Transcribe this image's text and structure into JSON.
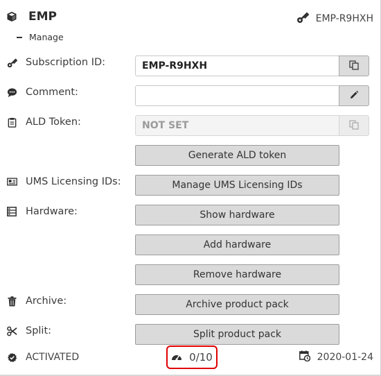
{
  "header": {
    "title": "EMP",
    "subscription_ref": "EMP-R9HXH",
    "manage_label": "Manage"
  },
  "rows": {
    "subscription": {
      "label": "Subscription ID:",
      "value": "EMP-R9HXH",
      "icon": "key-icon",
      "action_icon": "copy-icon"
    },
    "comment": {
      "label": "Comment:",
      "value": "",
      "icon": "speech-bubble-icon",
      "action_icon": "pencil-icon"
    },
    "ald_token": {
      "label": "ALD Token:",
      "value": "NOT SET",
      "icon": "clipboard-icon",
      "action_icon": "copy-icon",
      "generate_label": "Generate ALD token"
    },
    "ums": {
      "label": "UMS Licensing IDs:",
      "icon": "id-card-icon",
      "button_label": "Manage UMS Licensing IDs"
    },
    "hardware": {
      "label": "Hardware:",
      "icon": "list-icon",
      "show_label": "Show hardware",
      "add_label": "Add hardware",
      "remove_label": "Remove hardware"
    },
    "archive": {
      "label": "Archive:",
      "icon": "trash-icon",
      "button_label": "Archive product pack"
    },
    "split": {
      "label": "Split:",
      "icon": "scissors-icon",
      "button_label": "Split product pack"
    }
  },
  "footer": {
    "status": "ACTIVATED",
    "usage": "0/10",
    "date": "2020-01-24"
  }
}
